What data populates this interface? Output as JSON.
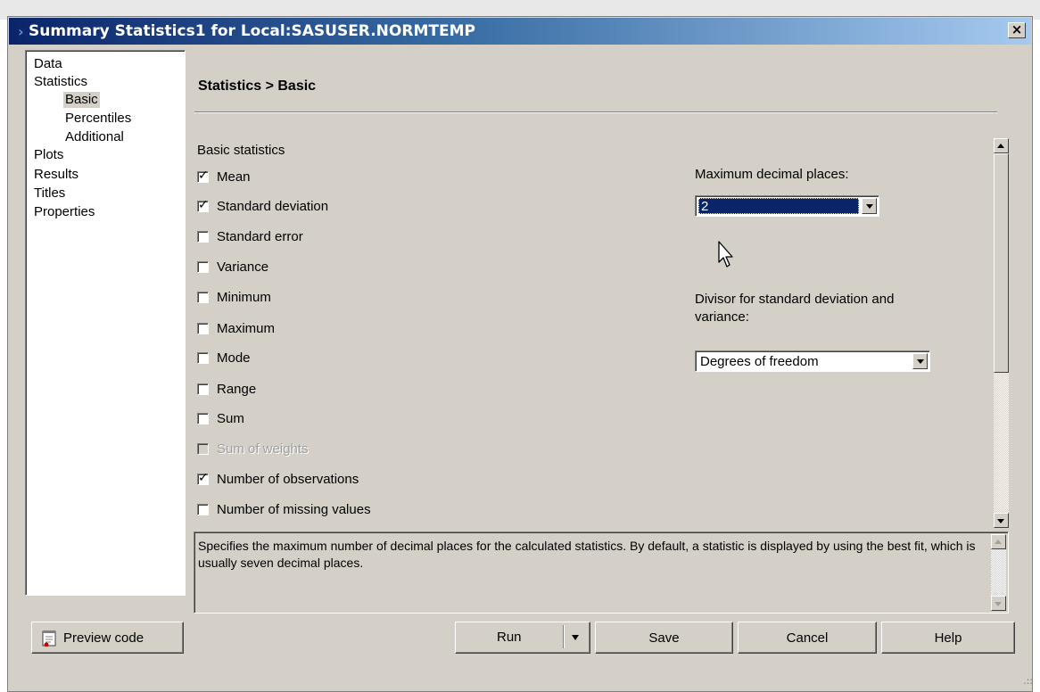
{
  "window": {
    "title": "Summary Statistics1 for Local:SASUSER.NORMTEMP",
    "close_glyph": "×"
  },
  "nav": {
    "items": [
      {
        "label": "Data",
        "level": 0
      },
      {
        "label": "Statistics",
        "level": 0
      },
      {
        "label": "Basic",
        "level": 1,
        "selected": true
      },
      {
        "label": "Percentiles",
        "level": 1
      },
      {
        "label": "Additional",
        "level": 1
      },
      {
        "label": "Plots",
        "level": 0
      },
      {
        "label": "Results",
        "level": 0
      },
      {
        "label": "Titles",
        "level": 0
      },
      {
        "label": "Properties",
        "level": 0
      }
    ]
  },
  "page": {
    "header": "Statistics > Basic",
    "section_label": "Basic statistics"
  },
  "statistics": [
    {
      "label": "Mean",
      "checked": true,
      "enabled": true
    },
    {
      "label": "Standard deviation",
      "checked": true,
      "enabled": true
    },
    {
      "label": "Standard error",
      "checked": false,
      "enabled": true
    },
    {
      "label": "Variance",
      "checked": false,
      "enabled": true
    },
    {
      "label": "Minimum",
      "checked": false,
      "enabled": true
    },
    {
      "label": "Maximum",
      "checked": false,
      "enabled": true
    },
    {
      "label": "Mode",
      "checked": false,
      "enabled": true
    },
    {
      "label": "Range",
      "checked": false,
      "enabled": true
    },
    {
      "label": "Sum",
      "checked": false,
      "enabled": true
    },
    {
      "label": "Sum of weights",
      "checked": false,
      "enabled": false
    },
    {
      "label": "Number of observations",
      "checked": true,
      "enabled": true
    },
    {
      "label": "Number of missing values",
      "checked": false,
      "enabled": true
    }
  ],
  "options": {
    "max_decimal_label": "Maximum decimal places:",
    "max_decimal_value": "2",
    "divisor_label_line1": "Divisor for standard deviation and",
    "divisor_label_line2": "variance:",
    "divisor_value": "Degrees of freedom"
  },
  "help": {
    "text": "Specifies the maximum number of decimal places for the calculated statistics. By default, a statistic is displayed by using the best fit, which is usually seven decimal places."
  },
  "buttons": {
    "preview": "Preview code",
    "run": "Run",
    "save": "Save",
    "cancel": "Cancel",
    "help": "Help"
  },
  "colors": {
    "selection": "#0a246a",
    "face": "#d4d0c8"
  }
}
